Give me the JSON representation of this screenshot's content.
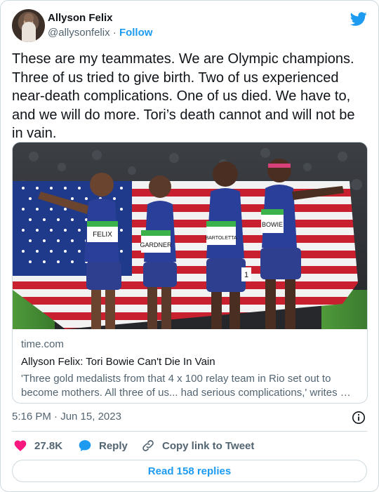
{
  "author": {
    "display_name": "Allyson Felix",
    "handle": "@allysonfelix",
    "separator": " · ",
    "follow_label": "Follow"
  },
  "tweet": {
    "text": "These are my teammates. We are Olympic champions. Three of us tried to give birth. Two of us experienced near-death complications. One of us died. We have to, and we will do more. Tori’s death cannot and will not be in vain."
  },
  "link_card": {
    "domain": "time.com",
    "title": "Allyson Felix: Tori Bowie Can't Die In Vain",
    "description": "'Three gold medalists from that 4 x 100 relay team in Rio set out to become mothers. All three of us... had serious complications,' writes …",
    "image": {
      "bibs": [
        "FELIX",
        "GARDNER",
        "BARTOLETTA",
        "BOWIE"
      ],
      "hip_number": "1"
    }
  },
  "meta": {
    "timestamp": "5:16 PM · Jun 15, 2023"
  },
  "actions": {
    "like_count": "27.8K",
    "reply_label": "Reply",
    "copy_label": "Copy link to Tweet"
  },
  "footer": {
    "read_replies_label": "Read 158 replies"
  },
  "colors": {
    "brand_blue": "#1d9bf0",
    "like_pink": "#f91880",
    "text_primary": "#0f1419",
    "text_secondary": "#536471",
    "border": "#cfd9de"
  },
  "icons": [
    "twitter-bird-icon",
    "info-icon",
    "heart-icon",
    "reply-bubble-icon",
    "link-icon"
  ]
}
